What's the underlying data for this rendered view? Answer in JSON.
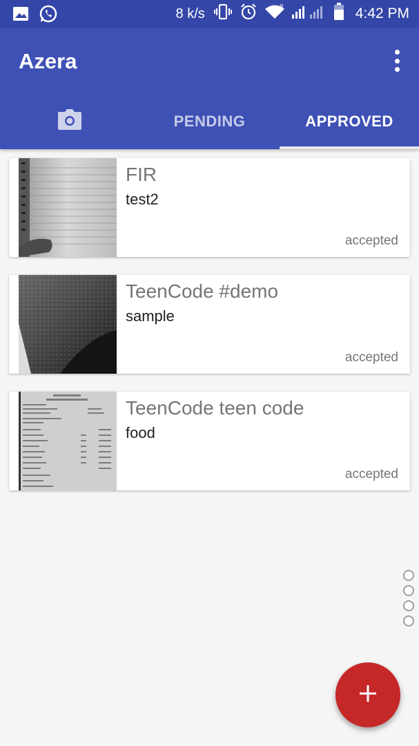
{
  "status_bar": {
    "speed": "8 k/s",
    "time": "4:42 PM",
    "icons": [
      "image-icon",
      "whatsapp-icon",
      "vibrate-icon",
      "alarm-icon",
      "wifi-icon",
      "signal-icon",
      "battery-icon"
    ]
  },
  "app_bar": {
    "title": "Azera",
    "menu_icon": "overflow-menu-icon"
  },
  "tabs": [
    {
      "label": "",
      "icon": "camera-icon",
      "selected": false
    },
    {
      "label": "PENDING",
      "selected": false
    },
    {
      "label": "APPROVED",
      "selected": true
    }
  ],
  "items": [
    {
      "title": "FIR",
      "subtitle": "test2",
      "status": "accepted",
      "thumbnail": "notebook-photo"
    },
    {
      "title": "TeenCode #demo",
      "subtitle": "sample",
      "status": "accepted",
      "thumbnail": "dark-texture-photo"
    },
    {
      "title": "TeenCode teen code",
      "subtitle": "food",
      "status": "accepted",
      "thumbnail": "receipt-photo"
    }
  ],
  "fab": {
    "icon": "plus-icon"
  },
  "colors": {
    "status_bar": "#3446a8",
    "app_bar": "#3f51b5",
    "fab": "#c62828",
    "background": "#f5f5f5"
  }
}
